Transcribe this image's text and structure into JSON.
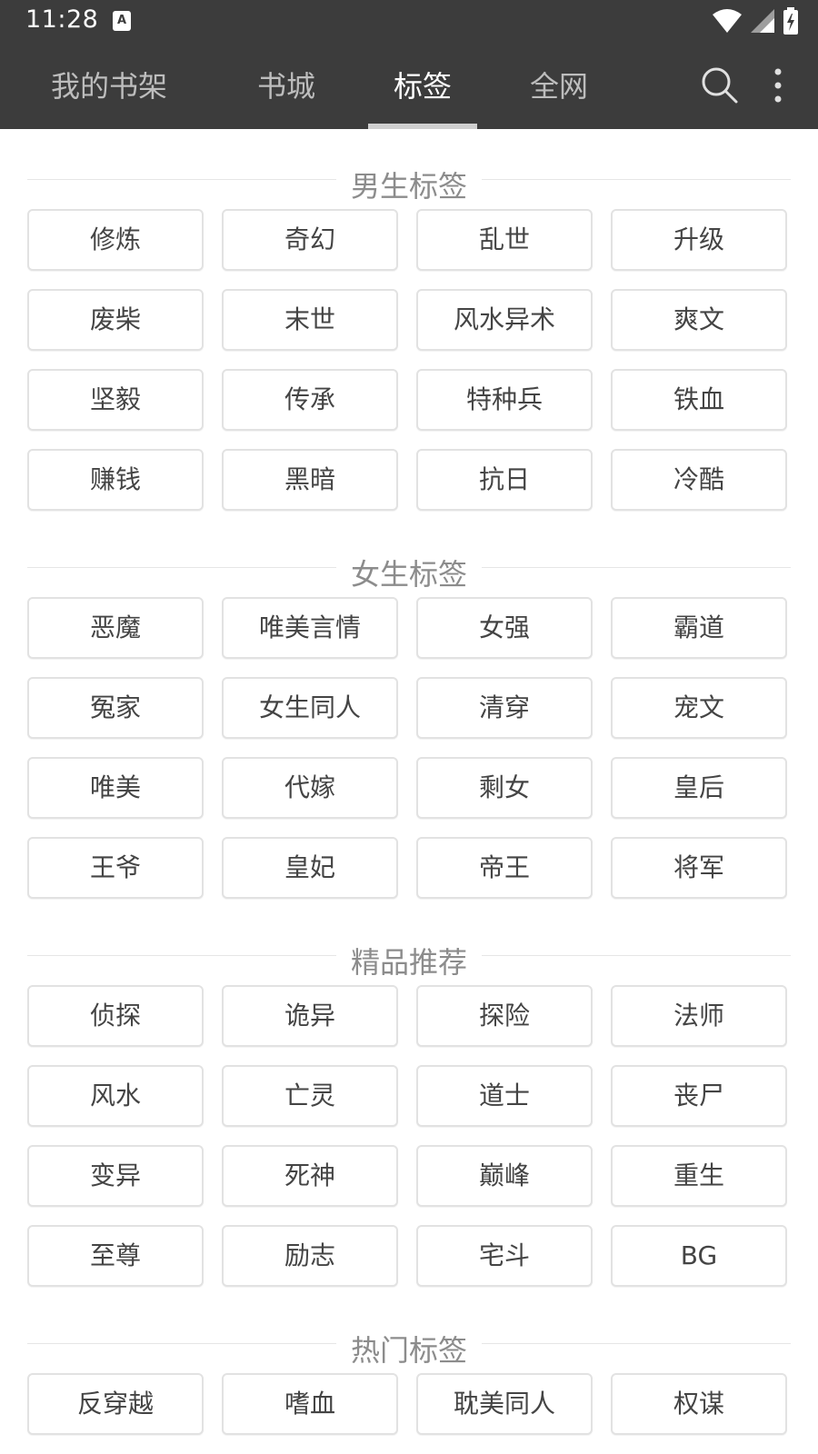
{
  "status_bar": {
    "time": "11:28",
    "notification_icon": "text-a-icon",
    "icons": [
      "wifi-icon",
      "signal-icon",
      "battery-charging-icon"
    ]
  },
  "toolbar": {
    "tabs": [
      {
        "label": "我的书架"
      },
      {
        "label": "书城"
      },
      {
        "label": "标签",
        "active": true
      },
      {
        "label": "全网"
      }
    ],
    "search_icon": "search-icon",
    "more_icon": "more-vertical-icon"
  },
  "sections": [
    {
      "title": "男生标签",
      "tags": [
        "修炼",
        "奇幻",
        "乱世",
        "升级",
        "废柴",
        "末世",
        "风水异术",
        "爽文",
        "坚毅",
        "传承",
        "特种兵",
        "铁血",
        "赚钱",
        "黑暗",
        "抗日",
        "冷酷"
      ]
    },
    {
      "title": "女生标签",
      "tags": [
        "恶魔",
        "唯美言情",
        "女强",
        "霸道",
        "冤家",
        "女生同人",
        "清穿",
        "宠文",
        "唯美",
        "代嫁",
        "剩女",
        "皇后",
        "王爷",
        "皇妃",
        "帝王",
        "将军"
      ]
    },
    {
      "title": "精品推荐",
      "tags": [
        "侦探",
        "诡异",
        "探险",
        "法师",
        "风水",
        "亡灵",
        "道士",
        "丧尸",
        "变异",
        "死神",
        "巅峰",
        "重生",
        "至尊",
        "励志",
        "宅斗",
        "BG"
      ]
    },
    {
      "title": "热门标签",
      "tags": [
        "反穿越",
        "嗜血",
        "耽美同人",
        "权谋"
      ]
    }
  ],
  "colors": {
    "toolbar_bg": "#3c3c3c",
    "tab_active": "#ffffff",
    "tab_inactive": "#bdbdbd",
    "tag_border": "#e2e2e2",
    "section_title": "#8c8c8c"
  }
}
